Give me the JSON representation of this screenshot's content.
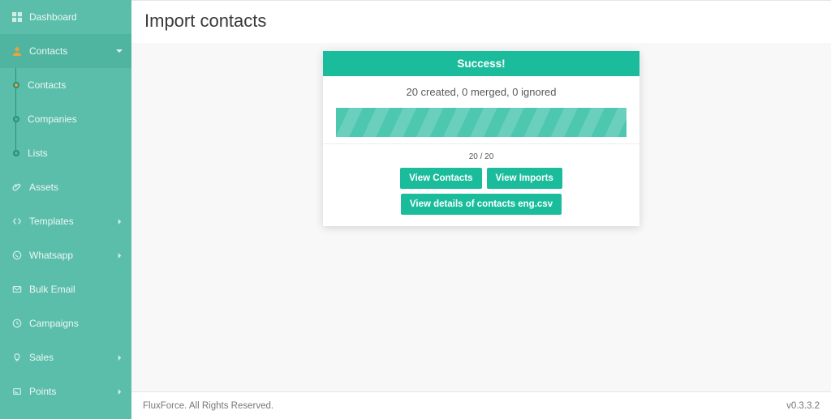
{
  "sidebar": {
    "items": [
      {
        "label": "Dashboard"
      },
      {
        "label": "Contacts"
      },
      {
        "label": "Assets"
      },
      {
        "label": "Templates"
      },
      {
        "label": "Whatsapp"
      },
      {
        "label": "Bulk Email"
      },
      {
        "label": "Campaigns"
      },
      {
        "label": "Sales"
      },
      {
        "label": "Points"
      }
    ],
    "sub_contacts": [
      {
        "label": "Contacts"
      },
      {
        "label": "Companies"
      },
      {
        "label": "Lists"
      }
    ]
  },
  "page": {
    "title": "Import contacts"
  },
  "card": {
    "header": "Success!",
    "stats": "20 created, 0 merged, 0 ignored",
    "count": "20 / 20",
    "buttons": {
      "view_contacts": "View Contacts",
      "view_imports": "View Imports",
      "view_details": "View details of contacts eng.csv"
    }
  },
  "footer": {
    "left": "FluxForce. All Rights Reserved.",
    "version": "v0.3.3.2"
  }
}
